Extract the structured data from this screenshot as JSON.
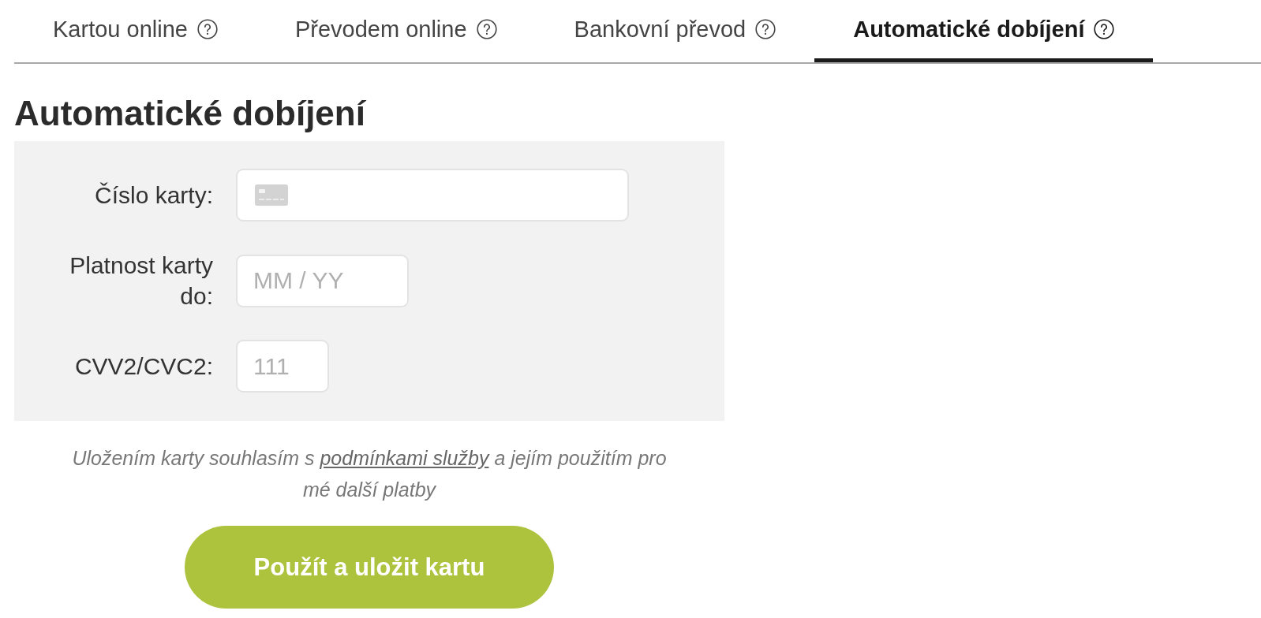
{
  "tabs": [
    {
      "label": "Kartou online",
      "selected": false
    },
    {
      "label": "Převodem online",
      "selected": false
    },
    {
      "label": "Bankovní převod",
      "selected": false
    },
    {
      "label": "Automatické dobíjení",
      "selected": true
    }
  ],
  "heading": "Automatické dobíjení",
  "form": {
    "fields": [
      {
        "kind": "card_number",
        "label": "Číslo karty:"
      },
      {
        "kind": "expiry",
        "label": "Platnost karty do:",
        "placeholder": "MM / YY"
      },
      {
        "kind": "cvv",
        "label": "CVV2/CVC2:",
        "placeholder": "111"
      }
    ]
  },
  "consent": {
    "text_before": "Uložením karty souhlasím s",
    "link": "podmínkami služby",
    "text_after": "a jejím použitím pro mé další platby"
  },
  "button": {
    "label": "Použít a uložit kartu"
  }
}
